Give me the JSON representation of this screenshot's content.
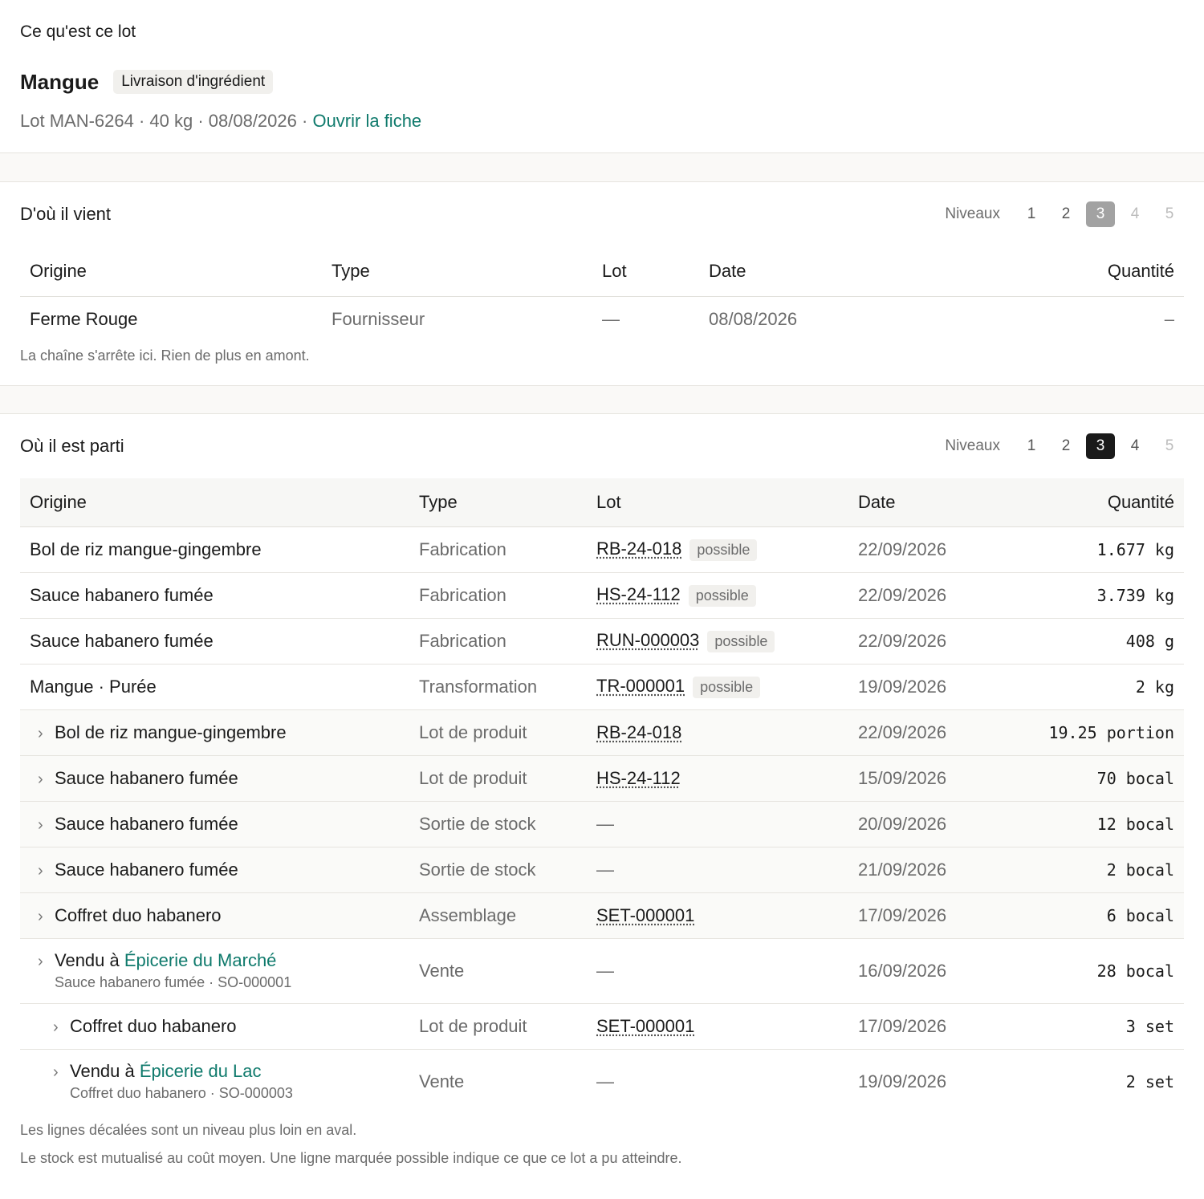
{
  "overview": {
    "section_label": "Ce qu'est ce lot",
    "product_name": "Mangue",
    "badge": "Livraison d'ingrédient",
    "meta": "Lot MAN-6264 · 40 kg · 08/08/2026 ·",
    "open_link": "Ouvrir la fiche"
  },
  "upstream": {
    "title": "D'où il vient",
    "levels_label": "Niveaux",
    "levels": [
      "1",
      "2",
      "3",
      "4",
      "5"
    ],
    "active_level": "3",
    "columns": [
      "Origine",
      "Type",
      "Lot",
      "Date",
      "Quantité"
    ],
    "rows": [
      {
        "origin": "Ferme Rouge",
        "type": "Fournisseur",
        "lot": "—",
        "date": "08/08/2026",
        "qty": "–"
      }
    ],
    "note": "La chaîne s'arrête ici. Rien de plus en amont."
  },
  "downstream": {
    "title": "Où il est parti",
    "levels_label": "Niveaux",
    "levels": [
      "1",
      "2",
      "3",
      "4",
      "5"
    ],
    "active_level": "3",
    "columns": [
      "Origine",
      "Type",
      "Lot",
      "Date",
      "Quantité"
    ],
    "possible_label": "possible",
    "rows": [
      {
        "origin": "Bol de riz mangue-gingembre",
        "type": "Fabrication",
        "lot": "RB-24-018",
        "possible": true,
        "date": "22/09/2026",
        "qty": "1.677 kg"
      },
      {
        "origin": "Sauce habanero fumée",
        "type": "Fabrication",
        "lot": "HS-24-112",
        "possible": true,
        "date": "22/09/2026",
        "qty": "3.739 kg"
      },
      {
        "origin": "Sauce habanero fumée",
        "type": "Fabrication",
        "lot": "RUN-000003",
        "possible": true,
        "date": "22/09/2026",
        "qty": "408 g"
      },
      {
        "origin": "Mangue · Purée",
        "type": "Transformation",
        "lot": "TR-000001",
        "possible": true,
        "date": "19/09/2026",
        "qty": "2 kg"
      },
      {
        "origin": "Bol de riz mangue-gingembre",
        "type": "Lot de produit",
        "lot": "RB-24-018",
        "date": "22/09/2026",
        "qty": "19.25 portion"
      },
      {
        "origin": "Sauce habanero fumée",
        "type": "Lot de produit",
        "lot": "HS-24-112",
        "date": "15/09/2026",
        "qty": "70 bocal"
      },
      {
        "origin": "Sauce habanero fumée",
        "type": "Sortie de stock",
        "lot": "—",
        "date": "20/09/2026",
        "qty": "12 bocal"
      },
      {
        "origin": "Sauce habanero fumée",
        "type": "Sortie de stock",
        "lot": "—",
        "date": "21/09/2026",
        "qty": "2 bocal"
      },
      {
        "origin": "Coffret duo habanero",
        "type": "Assemblage",
        "lot": "SET-000001",
        "date": "17/09/2026",
        "qty": "6 bocal"
      },
      {
        "origin_prefix": "Vendu à",
        "customer": "Épicerie du Marché",
        "subline": "Sauce habanero fumée · SO-000001",
        "type": "Vente",
        "lot": "—",
        "date": "16/09/2026",
        "qty": "28 bocal"
      },
      {
        "origin": "Coffret duo habanero",
        "type": "Lot de produit",
        "lot": "SET-000001",
        "date": "17/09/2026",
        "qty": "3 set"
      },
      {
        "origin_prefix": "Vendu à",
        "customer": "Épicerie du Lac",
        "subline": "Coffret duo habanero · SO-000003",
        "type": "Vente",
        "lot": "—",
        "date": "19/09/2026",
        "qty": "2 set"
      }
    ],
    "note_1": "Les lignes décalées sont un niveau plus loin en aval.",
    "note_2": "Le stock est mutualisé au coût moyen. Une ligne marquée possible indique ce que ce lot a pu atteindre."
  }
}
